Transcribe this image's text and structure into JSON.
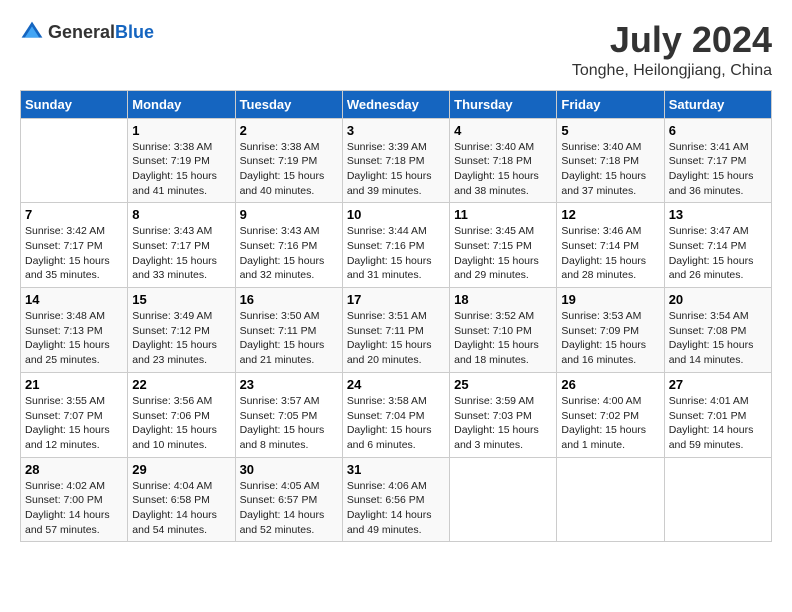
{
  "header": {
    "logo_general": "General",
    "logo_blue": "Blue",
    "month_year": "July 2024",
    "location": "Tonghe, Heilongjiang, China"
  },
  "days_of_week": [
    "Sunday",
    "Monday",
    "Tuesday",
    "Wednesday",
    "Thursday",
    "Friday",
    "Saturday"
  ],
  "weeks": [
    [
      {
        "day": "",
        "info": ""
      },
      {
        "day": "1",
        "info": "Sunrise: 3:38 AM\nSunset: 7:19 PM\nDaylight: 15 hours\nand 41 minutes."
      },
      {
        "day": "2",
        "info": "Sunrise: 3:38 AM\nSunset: 7:19 PM\nDaylight: 15 hours\nand 40 minutes."
      },
      {
        "day": "3",
        "info": "Sunrise: 3:39 AM\nSunset: 7:18 PM\nDaylight: 15 hours\nand 39 minutes."
      },
      {
        "day": "4",
        "info": "Sunrise: 3:40 AM\nSunset: 7:18 PM\nDaylight: 15 hours\nand 38 minutes."
      },
      {
        "day": "5",
        "info": "Sunrise: 3:40 AM\nSunset: 7:18 PM\nDaylight: 15 hours\nand 37 minutes."
      },
      {
        "day": "6",
        "info": "Sunrise: 3:41 AM\nSunset: 7:17 PM\nDaylight: 15 hours\nand 36 minutes."
      }
    ],
    [
      {
        "day": "7",
        "info": "Sunrise: 3:42 AM\nSunset: 7:17 PM\nDaylight: 15 hours\nand 35 minutes."
      },
      {
        "day": "8",
        "info": "Sunrise: 3:43 AM\nSunset: 7:17 PM\nDaylight: 15 hours\nand 33 minutes."
      },
      {
        "day": "9",
        "info": "Sunrise: 3:43 AM\nSunset: 7:16 PM\nDaylight: 15 hours\nand 32 minutes."
      },
      {
        "day": "10",
        "info": "Sunrise: 3:44 AM\nSunset: 7:16 PM\nDaylight: 15 hours\nand 31 minutes."
      },
      {
        "day": "11",
        "info": "Sunrise: 3:45 AM\nSunset: 7:15 PM\nDaylight: 15 hours\nand 29 minutes."
      },
      {
        "day": "12",
        "info": "Sunrise: 3:46 AM\nSunset: 7:14 PM\nDaylight: 15 hours\nand 28 minutes."
      },
      {
        "day": "13",
        "info": "Sunrise: 3:47 AM\nSunset: 7:14 PM\nDaylight: 15 hours\nand 26 minutes."
      }
    ],
    [
      {
        "day": "14",
        "info": "Sunrise: 3:48 AM\nSunset: 7:13 PM\nDaylight: 15 hours\nand 25 minutes."
      },
      {
        "day": "15",
        "info": "Sunrise: 3:49 AM\nSunset: 7:12 PM\nDaylight: 15 hours\nand 23 minutes."
      },
      {
        "day": "16",
        "info": "Sunrise: 3:50 AM\nSunset: 7:11 PM\nDaylight: 15 hours\nand 21 minutes."
      },
      {
        "day": "17",
        "info": "Sunrise: 3:51 AM\nSunset: 7:11 PM\nDaylight: 15 hours\nand 20 minutes."
      },
      {
        "day": "18",
        "info": "Sunrise: 3:52 AM\nSunset: 7:10 PM\nDaylight: 15 hours\nand 18 minutes."
      },
      {
        "day": "19",
        "info": "Sunrise: 3:53 AM\nSunset: 7:09 PM\nDaylight: 15 hours\nand 16 minutes."
      },
      {
        "day": "20",
        "info": "Sunrise: 3:54 AM\nSunset: 7:08 PM\nDaylight: 15 hours\nand 14 minutes."
      }
    ],
    [
      {
        "day": "21",
        "info": "Sunrise: 3:55 AM\nSunset: 7:07 PM\nDaylight: 15 hours\nand 12 minutes."
      },
      {
        "day": "22",
        "info": "Sunrise: 3:56 AM\nSunset: 7:06 PM\nDaylight: 15 hours\nand 10 minutes."
      },
      {
        "day": "23",
        "info": "Sunrise: 3:57 AM\nSunset: 7:05 PM\nDaylight: 15 hours\nand 8 minutes."
      },
      {
        "day": "24",
        "info": "Sunrise: 3:58 AM\nSunset: 7:04 PM\nDaylight: 15 hours\nand 6 minutes."
      },
      {
        "day": "25",
        "info": "Sunrise: 3:59 AM\nSunset: 7:03 PM\nDaylight: 15 hours\nand 3 minutes."
      },
      {
        "day": "26",
        "info": "Sunrise: 4:00 AM\nSunset: 7:02 PM\nDaylight: 15 hours\nand 1 minute."
      },
      {
        "day": "27",
        "info": "Sunrise: 4:01 AM\nSunset: 7:01 PM\nDaylight: 14 hours\nand 59 minutes."
      }
    ],
    [
      {
        "day": "28",
        "info": "Sunrise: 4:02 AM\nSunset: 7:00 PM\nDaylight: 14 hours\nand 57 minutes."
      },
      {
        "day": "29",
        "info": "Sunrise: 4:04 AM\nSunset: 6:58 PM\nDaylight: 14 hours\nand 54 minutes."
      },
      {
        "day": "30",
        "info": "Sunrise: 4:05 AM\nSunset: 6:57 PM\nDaylight: 14 hours\nand 52 minutes."
      },
      {
        "day": "31",
        "info": "Sunrise: 4:06 AM\nSunset: 6:56 PM\nDaylight: 14 hours\nand 49 minutes."
      },
      {
        "day": "",
        "info": ""
      },
      {
        "day": "",
        "info": ""
      },
      {
        "day": "",
        "info": ""
      }
    ]
  ]
}
